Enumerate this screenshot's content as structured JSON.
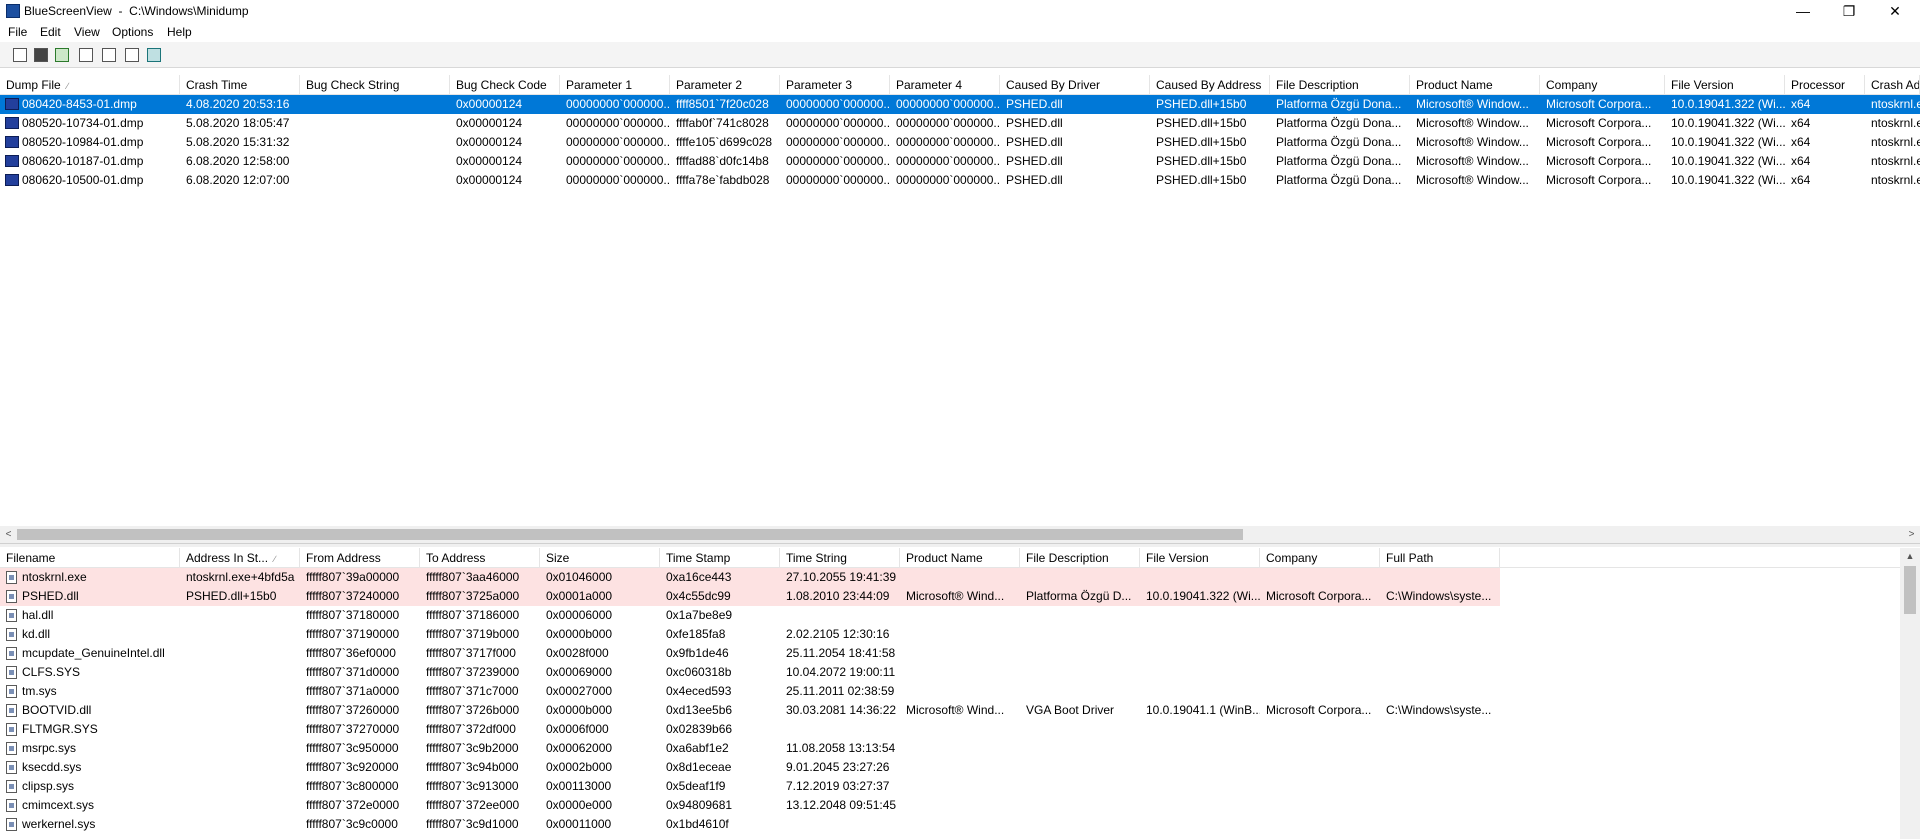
{
  "window": {
    "title": "BlueScreenView  -  C:\\Windows\\Minidump",
    "minimize_glyph": "—",
    "maximize_glyph": "❐",
    "close_glyph": "✕"
  },
  "menu": [
    "File",
    "Edit",
    "View",
    "Options",
    "Help"
  ],
  "toolbar": [
    "properties-icon",
    "save-icon",
    "refresh-icon",
    "copy-icon",
    "report-icon",
    "find-icon",
    "exit-icon"
  ],
  "upper": {
    "columns": [
      "Dump File",
      "Crash Time",
      "Bug Check String",
      "Bug Check Code",
      "Parameter 1",
      "Parameter 2",
      "Parameter 3",
      "Parameter 4",
      "Caused By Driver",
      "Caused By Address",
      "File Description",
      "Product Name",
      "Company",
      "File Version",
      "Processor",
      "Crash Addr"
    ],
    "sort_mark": "∕",
    "rows": [
      [
        "080420-8453-01.dmp",
        "4.08.2020 20:53:16",
        "",
        "0x00000124",
        "00000000`000000...",
        "ffff8501`7f20c028",
        "00000000`000000...",
        "00000000`000000...",
        "PSHED.dll",
        "PSHED.dll+15b0",
        "Platforma Özgü Dona...",
        "Microsoft® Window...",
        "Microsoft Corpora...",
        "10.0.19041.322 (Wi...",
        "x64",
        "ntoskrnl.e"
      ],
      [
        "080520-10734-01.dmp",
        "5.08.2020 18:05:47",
        "",
        "0x00000124",
        "00000000`000000...",
        "ffffab0f`741c8028",
        "00000000`000000...",
        "00000000`000000...",
        "PSHED.dll",
        "PSHED.dll+15b0",
        "Platforma Özgü Dona...",
        "Microsoft® Window...",
        "Microsoft Corpora...",
        "10.0.19041.322 (Wi...",
        "x64",
        "ntoskrnl.e"
      ],
      [
        "080520-10984-01.dmp",
        "5.08.2020 15:31:32",
        "",
        "0x00000124",
        "00000000`000000...",
        "ffffe105`d699c028",
        "00000000`000000...",
        "00000000`000000...",
        "PSHED.dll",
        "PSHED.dll+15b0",
        "Platforma Özgü Dona...",
        "Microsoft® Window...",
        "Microsoft Corpora...",
        "10.0.19041.322 (Wi...",
        "x64",
        "ntoskrnl.e"
      ],
      [
        "080620-10187-01.dmp",
        "6.08.2020 12:58:00",
        "",
        "0x00000124",
        "00000000`000000...",
        "ffffad88`d0fc14b8",
        "00000000`000000...",
        "00000000`000000...",
        "PSHED.dll",
        "PSHED.dll+15b0",
        "Platforma Özgü Dona...",
        "Microsoft® Window...",
        "Microsoft Corpora...",
        "10.0.19041.322 (Wi...",
        "x64",
        "ntoskrnl.e"
      ],
      [
        "080620-10500-01.dmp",
        "6.08.2020 12:07:00",
        "",
        "0x00000124",
        "00000000`000000...",
        "ffffa78e`fabdb028",
        "00000000`000000...",
        "00000000`000000...",
        "PSHED.dll",
        "PSHED.dll+15b0",
        "Platforma Özgü Dona...",
        "Microsoft® Window...",
        "Microsoft Corpora...",
        "10.0.19041.322 (Wi...",
        "x64",
        "ntoskrnl.e"
      ]
    ],
    "selected_row": 0
  },
  "hscroll": {
    "left_arrow": "<",
    "right_arrow": ">"
  },
  "vscroll": {
    "up_arrow": "▲",
    "down_arrow": "▼"
  },
  "lower": {
    "columns": [
      "Filename",
      "Address In St...",
      "From Address",
      "To Address",
      "Size",
      "Time Stamp",
      "Time String",
      "Product Name",
      "File Description",
      "File Version",
      "Company",
      "Full Path"
    ],
    "sort_mark": "∕",
    "rows": [
      [
        "ntoskrnl.exe",
        "ntoskrnl.exe+4bfd5a",
        "fffff807`39a00000",
        "fffff807`3aa46000",
        "0x01046000",
        "0xa16ce443",
        "27.10.2055 19:41:39",
        "",
        "",
        "",
        "",
        ""
      ],
      [
        "PSHED.dll",
        "PSHED.dll+15b0",
        "fffff807`37240000",
        "fffff807`3725a000",
        "0x0001a000",
        "0x4c55dc99",
        "1.08.2010 23:44:09",
        "Microsoft® Wind...",
        "Platforma Özgü D...",
        "10.0.19041.322 (Wi...",
        "Microsoft Corpora...",
        "C:\\Windows\\syste..."
      ],
      [
        "hal.dll",
        "",
        "fffff807`37180000",
        "fffff807`37186000",
        "0x00006000",
        "0x1a7be8e9",
        "",
        "",
        "",
        "",
        "",
        ""
      ],
      [
        "kd.dll",
        "",
        "fffff807`37190000",
        "fffff807`3719b000",
        "0x0000b000",
        "0xfe185fa8",
        "2.02.2105 12:30:16",
        "",
        "",
        "",
        "",
        ""
      ],
      [
        "mcupdate_GenuineIntel.dll",
        "",
        "fffff807`36ef0000",
        "fffff807`3717f000",
        "0x0028f000",
        "0x9fb1de46",
        "25.11.2054 18:41:58",
        "",
        "",
        "",
        "",
        ""
      ],
      [
        "CLFS.SYS",
        "",
        "fffff807`371d0000",
        "fffff807`37239000",
        "0x00069000",
        "0xc060318b",
        "10.04.2072 19:00:11",
        "",
        "",
        "",
        "",
        ""
      ],
      [
        "tm.sys",
        "",
        "fffff807`371a0000",
        "fffff807`371c7000",
        "0x00027000",
        "0x4eced593",
        "25.11.2011 02:38:59",
        "",
        "",
        "",
        "",
        ""
      ],
      [
        "BOOTVID.dll",
        "",
        "fffff807`37260000",
        "fffff807`3726b000",
        "0x0000b000",
        "0xd13ee5b6",
        "30.03.2081 14:36:22",
        "Microsoft® Wind...",
        "VGA Boot Driver",
        "10.0.19041.1 (WinB...",
        "Microsoft Corpora...",
        "C:\\Windows\\syste..."
      ],
      [
        "FLTMGR.SYS",
        "",
        "fffff807`37270000",
        "fffff807`372df000",
        "0x0006f000",
        "0x02839b66",
        "",
        "",
        "",
        "",
        "",
        ""
      ],
      [
        "msrpc.sys",
        "",
        "fffff807`3c950000",
        "fffff807`3c9b2000",
        "0x00062000",
        "0xa6abf1e2",
        "11.08.2058 13:13:54",
        "",
        "",
        "",
        "",
        ""
      ],
      [
        "ksecdd.sys",
        "",
        "fffff807`3c920000",
        "fffff807`3c94b000",
        "0x0002b000",
        "0x8d1eceae",
        "9.01.2045 23:27:26",
        "",
        "",
        "",
        "",
        ""
      ],
      [
        "clipsp.sys",
        "",
        "fffff807`3c800000",
        "fffff807`3c913000",
        "0x00113000",
        "0x5deaf1f9",
        "7.12.2019 03:27:37",
        "",
        "",
        "",
        "",
        ""
      ],
      [
        "cmimcext.sys",
        "",
        "fffff807`372e0000",
        "fffff807`372ee000",
        "0x0000e000",
        "0x94809681",
        "13.12.2048 09:51:45",
        "",
        "",
        "",
        "",
        ""
      ],
      [
        "werkernel.sys",
        "",
        "fffff807`3c9c0000",
        "fffff807`3c9d1000",
        "0x00011000",
        "0x1bd4610f",
        "",
        "",
        "",
        "",
        "",
        ""
      ]
    ],
    "highlighted_rows": [
      0,
      1
    ],
    "highlight_color": "#fde2e2"
  },
  "colors": {
    "selection": "#0078d7",
    "highlight": "#fde2e2"
  }
}
